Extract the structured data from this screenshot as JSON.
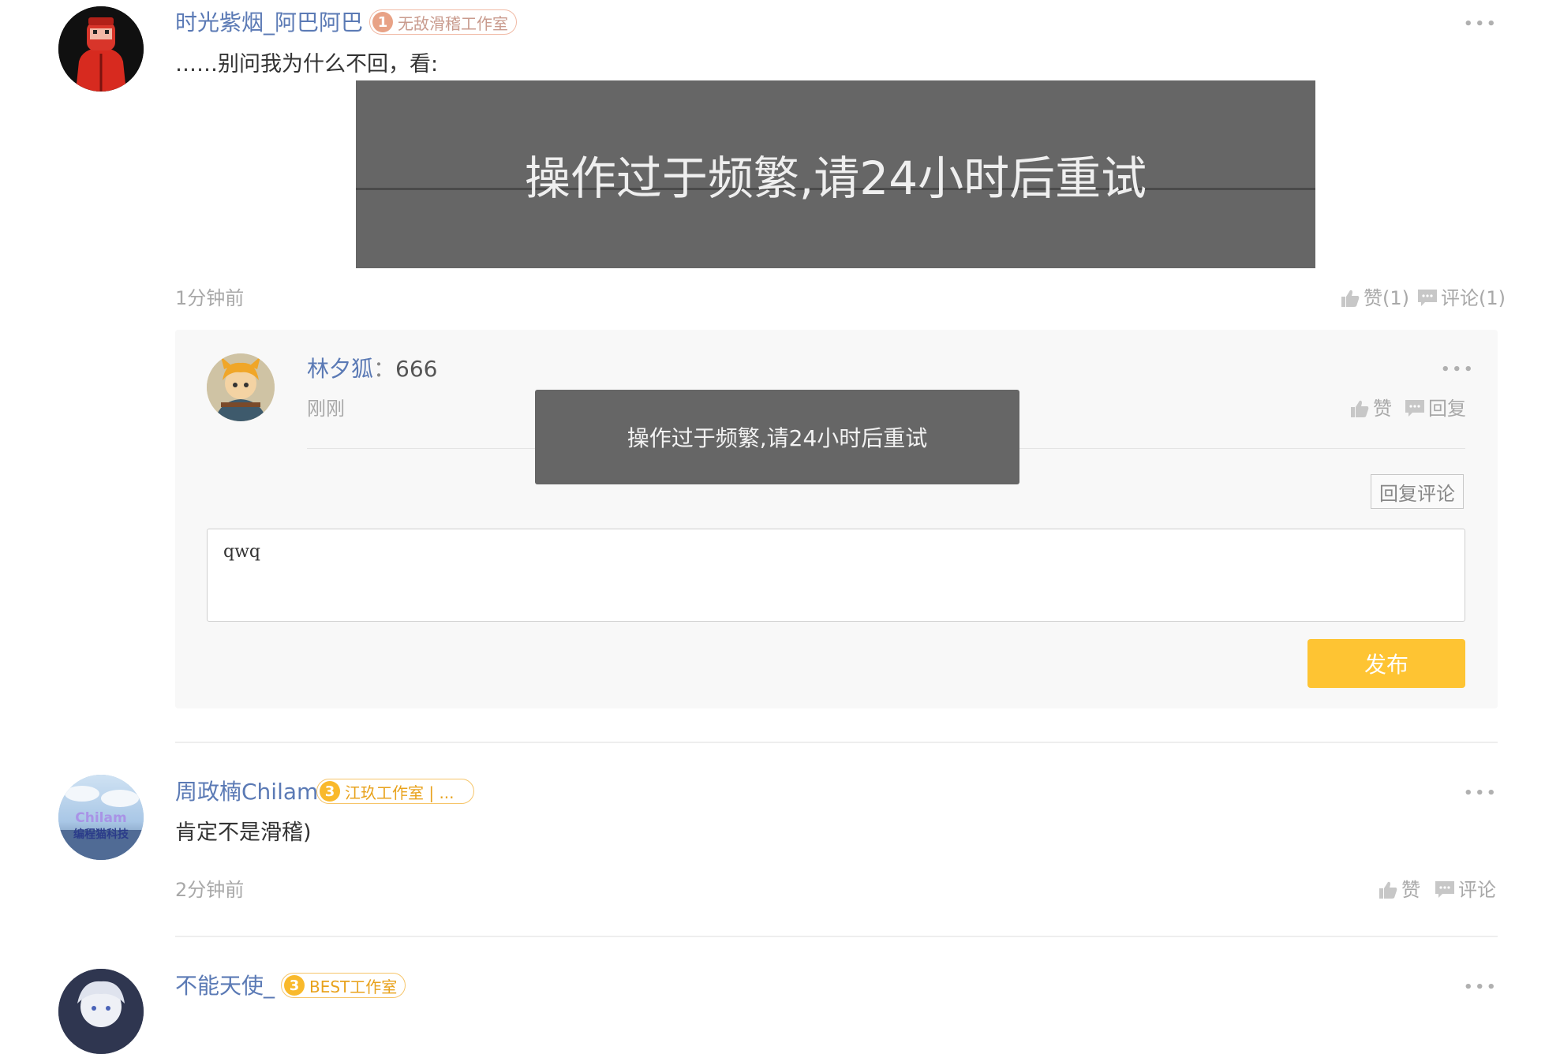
{
  "comments": [
    {
      "username": "时光紫烟_阿巴阿巴",
      "badge_num": "1",
      "badge_text": "无敌滑稽工作室",
      "content": "……别问我为什么不回，看:",
      "image_text": "操作过于频繁,请24小时后重试",
      "time": "1分钟前",
      "like_label": "赞(1)",
      "comment_label": "评论(1)",
      "more": "•••"
    },
    {
      "username": "周政楠Chilam",
      "badge_num": "3",
      "badge_text": "江玖工作室 | ...",
      "avatar_text_1": "Chilam",
      "avatar_text_2": "编程猫科技",
      "content": "肯定不是滑稽)",
      "time": "2分钟前",
      "like_label": "赞",
      "comment_label": "评论",
      "more": "•••"
    },
    {
      "username": "不能天使_",
      "badge_num": "3",
      "badge_text": "BEST工作室",
      "more": "•••"
    }
  ],
  "reply": {
    "username": "林夕狐",
    "separator": "：",
    "content": "666",
    "time": "刚刚",
    "like_label": "赞",
    "reply_label": "回复",
    "more": "•••",
    "reply_comment_button": "回复评论",
    "input_value": "qwq",
    "publish_button": "发布"
  },
  "toast": {
    "message": "操作过于频繁,请24小时后重试"
  },
  "colors": {
    "username": "#5b7ab5",
    "publish": "#fec433",
    "toast_bg": "#666666",
    "badge1": "#e8a286",
    "badge3": "#f9b92b"
  }
}
